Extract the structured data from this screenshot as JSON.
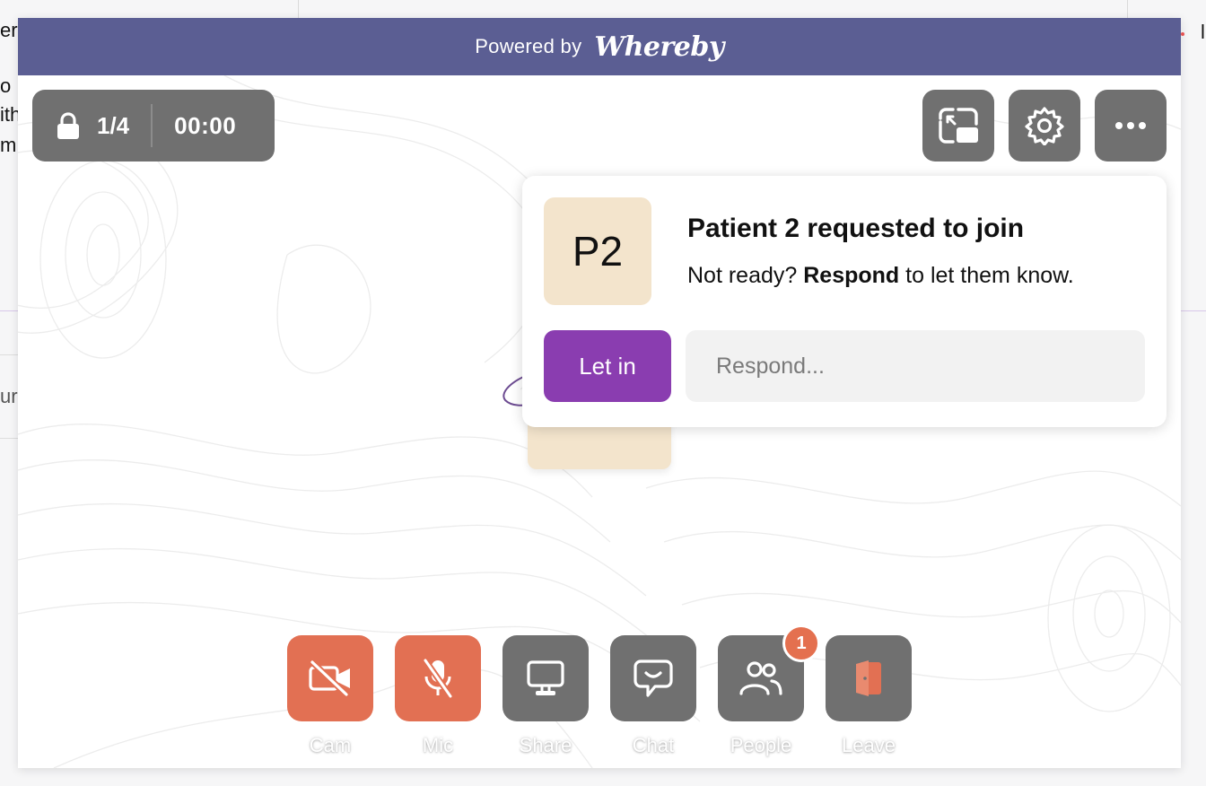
{
  "host_page": {
    "fragments": [
      "er",
      "o",
      "ith",
      "m",
      "ur",
      "l"
    ]
  },
  "banner": {
    "powered_by": "Powered by",
    "brand": "Whereby"
  },
  "room": {
    "participant_count": "1/4",
    "timer": "00:00",
    "lock_icon": "lock-icon"
  },
  "top_controls": [
    {
      "name": "picture-in-picture-icon"
    },
    {
      "name": "settings-icon"
    },
    {
      "name": "more-options-icon"
    }
  ],
  "join_request": {
    "avatar_initials": "P2",
    "title": "Patient 2 requested to join",
    "subtitle_prefix": "Not ready?",
    "subtitle_bold": "Respond",
    "subtitle_suffix": "to let them know.",
    "let_in_label": "Let in",
    "respond_placeholder": "Respond..."
  },
  "toolbar": {
    "cam_label": "Cam",
    "mic_label": "Mic",
    "share_label": "Share",
    "chat_label": "Chat",
    "people_label": "People",
    "people_badge": "1",
    "leave_label": "Leave"
  },
  "colors": {
    "banner": "#5b5e93",
    "control_grey": "#707070",
    "muted_red": "#e27053",
    "let_in_purple": "#8a3db0",
    "avatar_beige": "#f3e4cc"
  }
}
